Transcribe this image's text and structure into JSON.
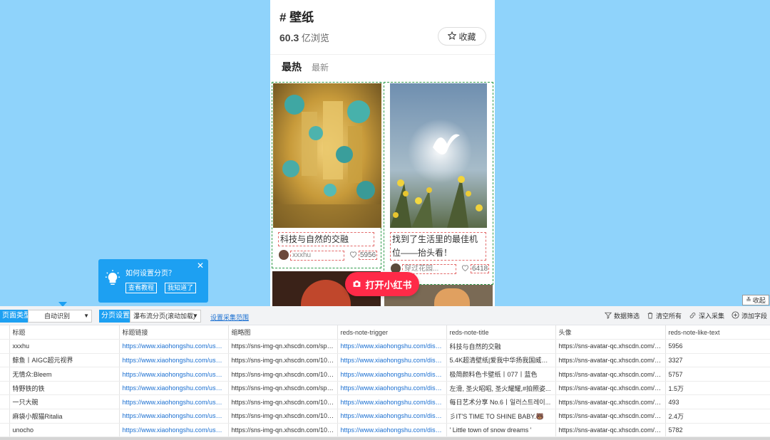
{
  "tag": {
    "title": "# 壁纸",
    "views_num": "60.3",
    "views_unit": " 亿浏览",
    "fav_label": "收藏"
  },
  "tabs": {
    "hot": "最热",
    "new": "最新"
  },
  "cards": [
    {
      "title": "科技与自然的交融",
      "author": "xxxhu",
      "likes": "5956"
    },
    {
      "title": "找到了生活里的最佳机位——抬头看！",
      "author": "穿过花园...",
      "likes": "6418"
    }
  ],
  "open_app_label": "打开小红书",
  "tooltip": {
    "title": "如何设置分页？",
    "tutorial": "查看教程",
    "got_it": "我知道了"
  },
  "collapse_label": "收起",
  "toolbar": {
    "page_type_label": "页面类型",
    "page_type_value": "自动识别",
    "paging_label": "分页设置",
    "paging_value": "瀑布流分页(滚动加载)",
    "range_link": "设置采集范围",
    "filter": "数据筛选",
    "clear": "清空所有",
    "deep": "深入采集",
    "add": "添加字段"
  },
  "columns": [
    "标题",
    "标题链接",
    "缩略图",
    "reds-note-trigger",
    "reds-note-title",
    "头像",
    "reds-note-like-text"
  ],
  "rows": [
    [
      "xxxhu",
      "https://www.xiaohongshu.com/user/...",
      "https://sns-img-qn.xhscdn.com/spect...",
      "https://www.xiaohongshu.com/disco...",
      "科技与自然的交融",
      "https://sns-avatar-qc.xhscdn.com/av...",
      "5956"
    ],
    [
      "鲸鱼丨AIGC超元视界",
      "https://www.xiaohongshu.com/user/...",
      "https://sns-img-qn.xhscdn.com/1040...",
      "https://www.xiaohongshu.com/disco...",
      "5.4K超清壁纸|爱我中华扬我国威丨国...",
      "https://sns-avatar-qc.xhscdn.com/av...",
      "3327"
    ],
    [
      "无情众:Bleem",
      "https://www.xiaohongshu.com/user/...",
      "https://sns-img-qn.xhscdn.com/1040...",
      "https://www.xiaohongshu.com/disco...",
      "极简颜料色卡壁纸丨077丨蓝色",
      "https://sns-avatar-qc.xhscdn.com/av...",
      "5757"
    ],
    [
      "特野铁的铁",
      "https://www.xiaohongshu.com/user/...",
      "https://sns-img-qn.xhscdn.com/spect...",
      "https://www.xiaohongshu.com/disco...",
      "左滑, 圣火昭昭, 圣火耀耀,#拍照姿...",
      "https://sns-avatar-qc.xhscdn.com/av...",
      "1.5万"
    ],
    [
      "一只大碗",
      "https://www.xiaohongshu.com/user/...",
      "https://sns-img-qn.xhscdn.com/1040...",
      "https://www.xiaohongshu.com/disco...",
      "每日艺术分享 No.6丨일러스트레이...",
      "https://sns-avatar-qc.xhscdn.com/av...",
      "493"
    ],
    [
      "麻袋小靓猫Ritalia",
      "https://www.xiaohongshu.com/user/...",
      "https://sns-img-qn.xhscdn.com/1000...",
      "https://www.xiaohongshu.com/disco...",
      "彡IT'S TIME TO SHINE BABY.🐻",
      "https://sns-avatar-qc.xhscdn.com/av...",
      "2.4万"
    ],
    [
      "unocho",
      "https://www.xiaohongshu.com/user/...",
      "https://sns-img-qn.xhscdn.com/1040...",
      "https://www.xiaohongshu.com/disco...",
      "' Little town of snow dreams '",
      "https://sns-avatar-qc.xhscdn.com/av...",
      "5782"
    ]
  ]
}
